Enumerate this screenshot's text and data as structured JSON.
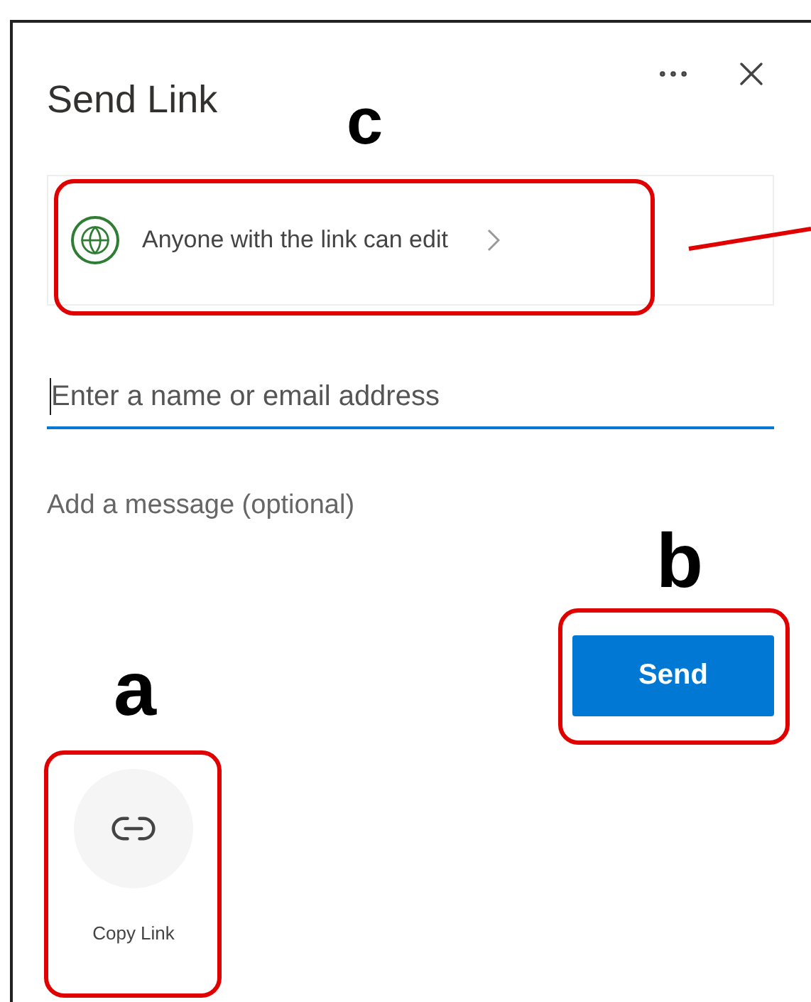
{
  "dialog": {
    "title": "Send Link",
    "permission": {
      "label": "Anyone with the link can edit"
    },
    "recipient_field": {
      "placeholder": "Enter a name or email address",
      "focused": true
    },
    "message_field": {
      "placeholder": "Add a message (optional)"
    },
    "send_button": {
      "label": "Send"
    },
    "copy_link": {
      "label": "Copy Link"
    }
  },
  "annotations": {
    "permission": "c",
    "send": "b",
    "copy_link": "a"
  }
}
